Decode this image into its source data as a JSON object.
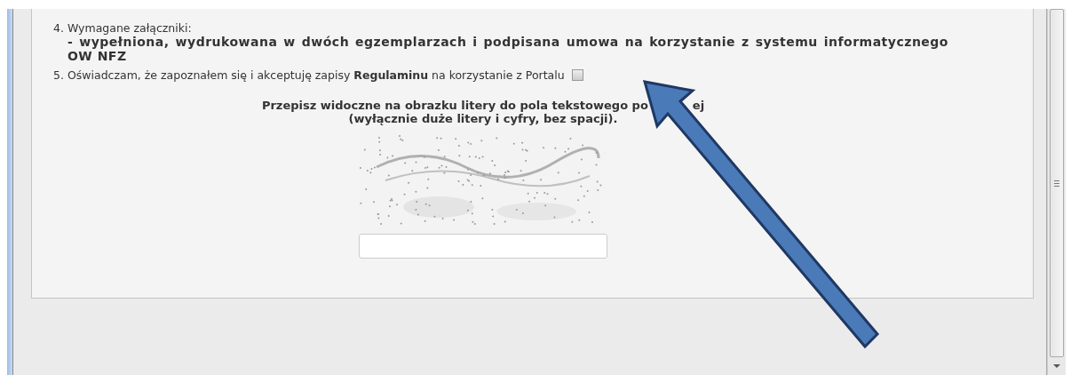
{
  "items": [
    {
      "number": "4.",
      "label": "Wymagane załączniki:",
      "detail": "- wypełniona, wydrukowana w dwóch egzemplarzach i podpisana umowa na korzystanie z systemu informatycznego OW NFZ"
    },
    {
      "number": "5.",
      "label": "Oświadczam, że zapoznałem się i akceptuję zapisy **Regulaminu** na korzystanie z Portalu",
      "checkbox": {
        "checked": false
      }
    }
  ],
  "captcha": {
    "instruction": [
      "Przepisz widoczne na obrazku litery do pola tekstowego po",
      "ej"
    ],
    "hint": "(wyłącznie duże litery i cyfry, bez spacji)."
  }
}
